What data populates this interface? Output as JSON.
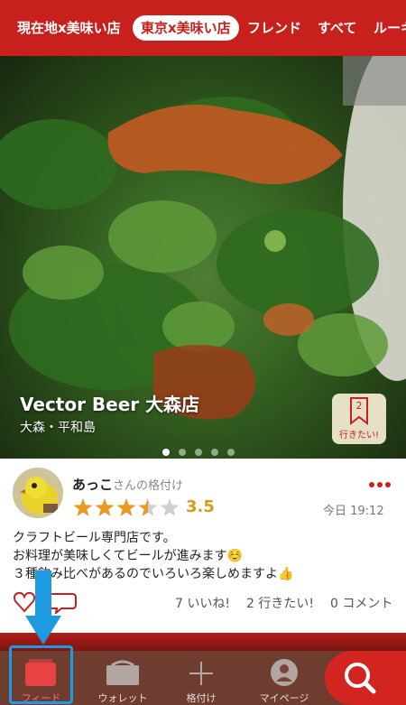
{
  "top_tabs": [
    {
      "label": "現在地x美味い店",
      "active": false
    },
    {
      "label": "東京x美味い店",
      "active": true
    },
    {
      "label": "フレンド",
      "active": false
    },
    {
      "label": "すべて",
      "active": false
    },
    {
      "label": "ルーキー",
      "active": false
    }
  ],
  "hero": {
    "shop_name": "Vector Beer 大森店",
    "area": "大森・平和島",
    "want_count": "2",
    "want_label": "行きたい!",
    "carousel_pages": 5,
    "carousel_active": 0
  },
  "review": {
    "user_name": "あっこ",
    "user_suffix": "さんの格付け",
    "rating": "3.5",
    "rating_value": 3.5,
    "posted": "今日 19:12",
    "more_icon": "more-dots-icon",
    "body_lines": [
      "クラフトビール専門店です。",
      "お料理が美味しくてビールが進みます☺️",
      "３種飲み比べがあるのでいろいろ楽しめますよ👍"
    ],
    "likes": "7 いいね!",
    "wants": "2 行きたい!",
    "comments": "0 コメント"
  },
  "bottom_nav": [
    {
      "label": "フィード",
      "icon": "feed-card-icon",
      "active": true
    },
    {
      "label": "ウォレット",
      "icon": "wallet-icon",
      "active": false
    },
    {
      "label": "格付け",
      "icon": "plus-icon",
      "active": false
    },
    {
      "label": "マイページ",
      "icon": "person-icon",
      "active": false
    }
  ],
  "colors": {
    "brand": "#c8201c",
    "star": "#e69a24",
    "highlight": "#1e9be0"
  }
}
